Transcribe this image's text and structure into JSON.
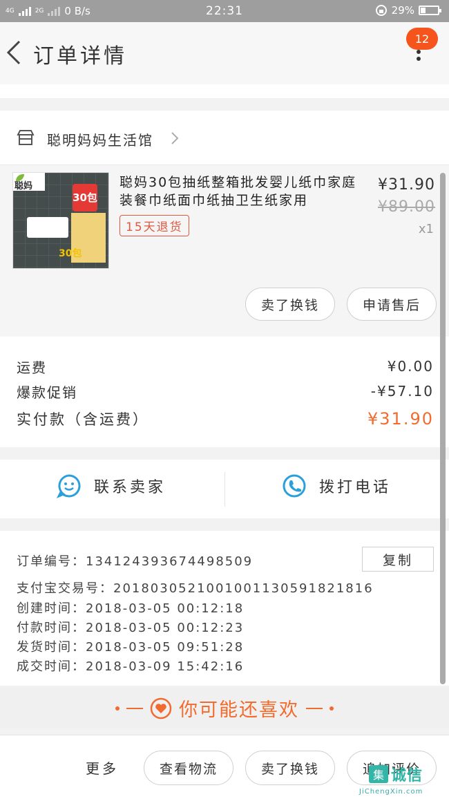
{
  "status_bar": {
    "network_left": "4G",
    "network_right": "2G",
    "speed": "0 B/s",
    "time": "22:31",
    "battery": "29%"
  },
  "header": {
    "title": "订单详情",
    "badge_count": "12"
  },
  "shop": {
    "name": "聪明妈妈生活馆"
  },
  "product": {
    "thumb_brand": "聪妈",
    "thumb_badge": "30包",
    "thumb_count": "30包",
    "name": "聪妈30包抽纸整箱批发婴儿纸巾家庭装餐巾纸面巾纸抽卫生纸家用",
    "tag": "15天退货",
    "price": "¥31.90",
    "original_price": "¥89.00",
    "quantity": "x1",
    "refund_button": "卖了换钱",
    "after_sale_button": "申请售后"
  },
  "summary": {
    "shipping_label": "运费",
    "shipping_value": "¥0.00",
    "promo_label": "爆款促销",
    "promo_value": "-¥57.10",
    "total_label": "实付款（含运费）",
    "total_value": "¥31.90"
  },
  "contact": {
    "seller_label": "联系卖家",
    "phone_label": "拨打电话"
  },
  "order_info": {
    "order_no_label": "订单编号：",
    "order_no": "134124393674498509",
    "copy_button": "复制",
    "alipay_label": "支付宝交易号：",
    "alipay_no": "2018030521001001130591821816",
    "created_label": "创建时间：",
    "created": "2018-03-05 00:12:18",
    "paid_label": "付款时间：",
    "paid": "2018-03-05 00:12:23",
    "shipped_label": "发货时间：",
    "shipped": "2018-03-05 09:51:28",
    "completed_label": "成交时间：",
    "completed": "2018-03-09 15:42:16"
  },
  "recommend": {
    "title": "你可能还喜欢"
  },
  "bottom_bar": {
    "more_label": "更多",
    "logistics_button": "查看物流",
    "sell_button": "卖了换钱",
    "review_button": "追加评价"
  },
  "watermark": {
    "mark": "集",
    "text": "诚信",
    "url": "JiChengXin.com"
  },
  "colors": {
    "accent": "#f26b2e",
    "badge": "#f5541c",
    "tag_red": "#e0573f",
    "contact_icon": "#2a9fdc"
  }
}
